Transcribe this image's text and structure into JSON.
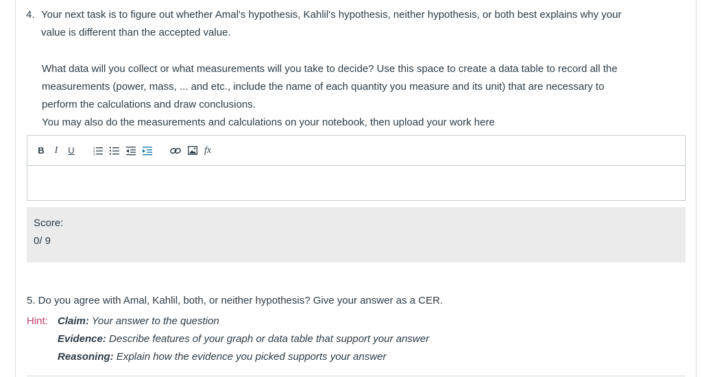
{
  "question4": {
    "number": "4.",
    "line1": "Your next task is to figure out whether Amal's hypothesis, Kahlil's hypothesis, neither hypothesis, or both best explains why your",
    "line2": "value is different than the accepted value."
  },
  "prompt": {
    "line1": "What data will you collect or what measurements will you take to decide? Use this space to create a data table to record all the",
    "line2": "measurements (power, mass, ... and etc., include the name of each quantity you measure and its unit) that are necessary to",
    "line3": "perform the calculations and draw conclusions.",
    "line4": "You may also do the measurements and calculations on your notebook, then upload your work here"
  },
  "toolbar": {
    "bold": "B",
    "italic": "I",
    "underline": "U",
    "fx": "fx",
    "icons": [
      "ordered-list-icon",
      "unordered-list-icon",
      "outdent-icon",
      "indent-icon",
      "link-icon",
      "image-icon",
      "equation-icon"
    ]
  },
  "score": {
    "label": "Score:",
    "value": "0/ 9"
  },
  "question5": {
    "text": "5. Do you agree with Amal, Kahlil, both, or neither hypothesis? Give your answer as a CER."
  },
  "hint": {
    "label": "Hint:",
    "claim_term": "Claim:",
    "claim_text": " Your answer to the question",
    "evidence_term": "Evidence:",
    "evidence_text": " Describe features of your graph or data table that support your answer",
    "reasoning_term": "Reasoning:",
    "reasoning_text": " Explain how the evidence you picked supports your answer"
  },
  "colors": {
    "text": "#2d3b45",
    "hint": "#c0396b",
    "score_bg": "#ebebeb",
    "accent_icon": "#0770a3"
  }
}
